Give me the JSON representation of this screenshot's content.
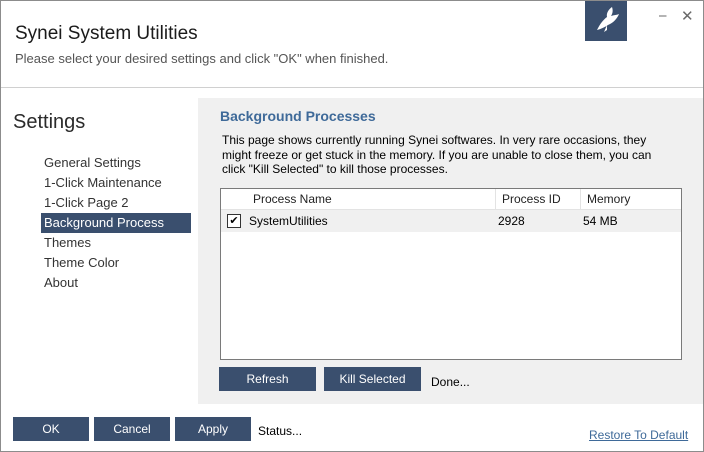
{
  "window": {
    "title": "Synei System Utilities",
    "subtitle": "Please select your desired settings and click \"OK\" when finished.",
    "minimize_glyph": "⎯",
    "close_glyph": "✕",
    "logo_icon": "bird-icon"
  },
  "sidebar": {
    "heading": "Settings",
    "items": [
      {
        "label": "General Settings",
        "active": false
      },
      {
        "label": "1-Click Maintenance",
        "active": false
      },
      {
        "label": "1-Click Page 2",
        "active": false
      },
      {
        "label": "Background Process",
        "active": true
      },
      {
        "label": "Themes",
        "active": false
      },
      {
        "label": "Theme Color",
        "active": false
      },
      {
        "label": "About",
        "active": false
      }
    ]
  },
  "panel": {
    "title": "Background Processes",
    "description": "This page shows currently running Synei softwares. In very rare occasions, they might freeze or  get stuck in the memory. If you are unable to close them, you can click \"Kill Selected\" to kill those processes.",
    "table": {
      "columns": [
        "Process Name",
        "Process ID",
        "Memory"
      ],
      "rows": [
        {
          "checked": true,
          "check_glyph": "✔",
          "name": "SystemUtilities",
          "pid": "2928",
          "memory": "54 MB"
        }
      ]
    },
    "buttons": {
      "refresh": "Refresh",
      "kill": "Kill Selected"
    },
    "status": "Done..."
  },
  "footer": {
    "ok": "OK",
    "cancel": "Cancel",
    "apply": "Apply",
    "status": "Status...",
    "restore": "Restore To Default"
  },
  "colors": {
    "accent": "#3a4f6e",
    "heading_blue": "#3f6a99",
    "panel_bg": "#f0f0f0"
  }
}
